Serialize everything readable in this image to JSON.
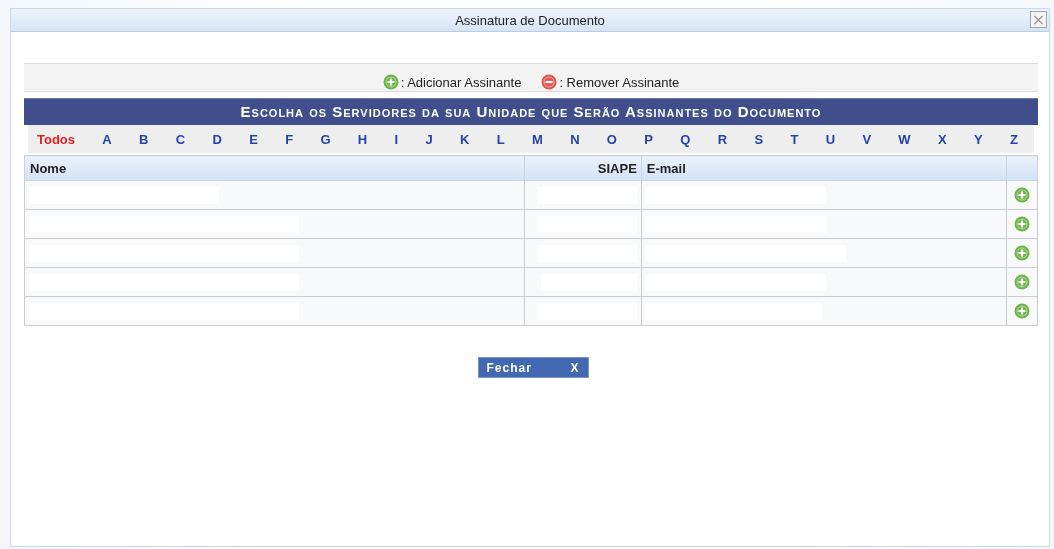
{
  "window": {
    "title": "Assinatura de Documento",
    "close": "×"
  },
  "legend": [
    {
      "kind": "add",
      "label": ": Adicionar Assinante"
    },
    {
      "kind": "remove",
      "label": ": Remover Assinante"
    }
  ],
  "heading": "Escolha os Servidores da sua Unidade que Serão Assinantes do Documento",
  "letters": [
    {
      "label": "Todos",
      "selected": true
    },
    {
      "label": "A",
      "selected": false
    },
    {
      "label": "B",
      "selected": false
    },
    {
      "label": "C",
      "selected": false
    },
    {
      "label": "D",
      "selected": false
    },
    {
      "label": "E",
      "selected": false
    },
    {
      "label": "F",
      "selected": false
    },
    {
      "label": "G",
      "selected": false
    },
    {
      "label": "H",
      "selected": false
    },
    {
      "label": "I",
      "selected": false
    },
    {
      "label": "J",
      "selected": false
    },
    {
      "label": "K",
      "selected": false
    },
    {
      "label": "L",
      "selected": false
    },
    {
      "label": "M",
      "selected": false
    },
    {
      "label": "N",
      "selected": false
    },
    {
      "label": "O",
      "selected": false
    },
    {
      "label": "P",
      "selected": false
    },
    {
      "label": "Q",
      "selected": false
    },
    {
      "label": "R",
      "selected": false
    },
    {
      "label": "S",
      "selected": false
    },
    {
      "label": "T",
      "selected": false
    },
    {
      "label": "U",
      "selected": false
    },
    {
      "label": "V",
      "selected": false
    },
    {
      "label": "W",
      "selected": false
    },
    {
      "label": "X",
      "selected": false
    },
    {
      "label": "Y",
      "selected": false
    },
    {
      "label": "Z",
      "selected": false
    }
  ],
  "table": {
    "columns": [
      "Nome",
      "SIAPE",
      "E-mail"
    ],
    "rows": [
      {
        "kind": "redacted"
      },
      {
        "kind": "redacted"
      },
      {
        "kind": "redacted"
      },
      {
        "kind": "redacted"
      },
      {
        "kind": "redacted"
      }
    ]
  },
  "buttons": [
    {
      "label": "Fechar",
      "icon": "X"
    }
  ]
}
